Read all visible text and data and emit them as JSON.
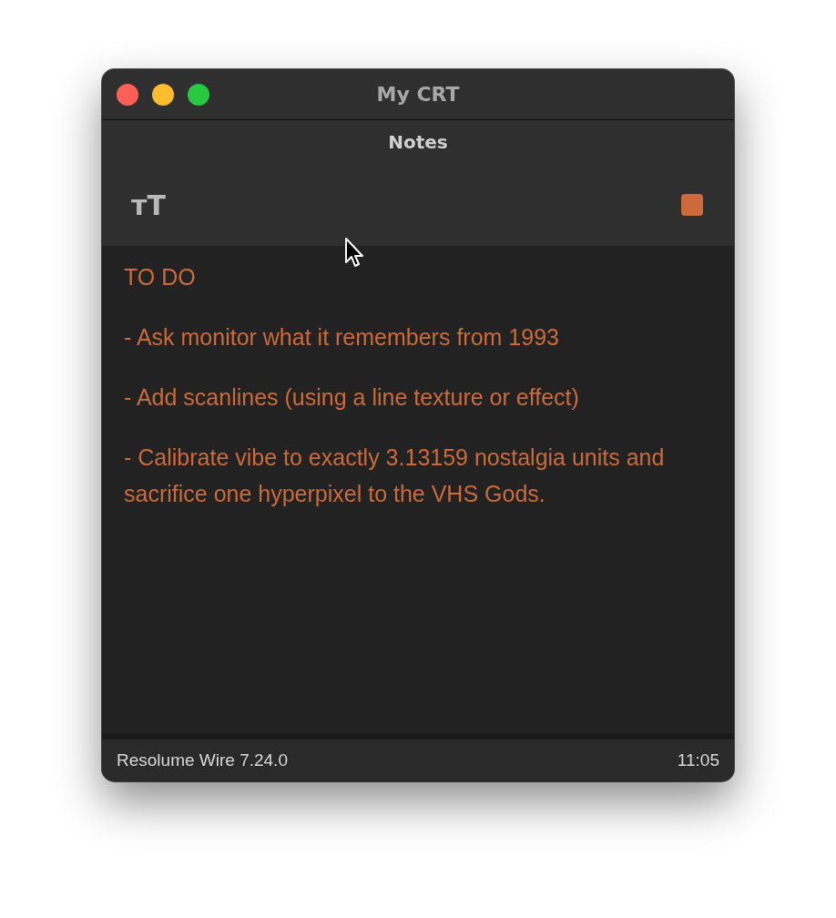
{
  "window": {
    "title": "My CRT"
  },
  "header": {
    "title": "Notes"
  },
  "toolbar": {
    "font_size_button": "ᴛT",
    "color_swatch": {
      "color": "#cc6a3a"
    }
  },
  "note": {
    "paragraphs": [
      "TO DO",
      "- Ask monitor what it remembers from 1993",
      "- Add scanlines (using a line texture or effect)",
      "- Calibrate vibe to exactly 3.13159 nostalgia units and sacrifice one hyperpixel to the VHS Gods."
    ]
  },
  "status_bar": {
    "app": "Resolume Wire 7.24.0",
    "time": "11:05"
  }
}
